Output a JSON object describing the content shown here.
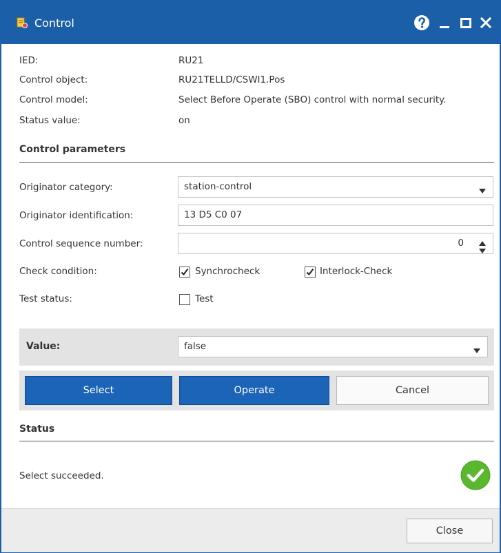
{
  "window": {
    "title": "Control"
  },
  "info": {
    "ied_label": "IED:",
    "ied_value": "RU21",
    "control_object_label": "Control object:",
    "control_object_value": "RU21TELLD/CSWI1.Pos",
    "control_model_label": "Control model:",
    "control_model_value": "Select Before Operate (SBO) control with normal security.",
    "status_value_label": "Status value:",
    "status_value_value": "on"
  },
  "control_parameters": {
    "title": "Control parameters",
    "originator_category_label": "Originator category:",
    "originator_category_value": "station-control",
    "originator_identification_label": "Originator identification:",
    "originator_identification_value": "13 D5 C0 07",
    "control_sequence_label": "Control sequence number:",
    "control_sequence_value": "0",
    "check_condition_label": "Check condition:",
    "synchrocheck_label": "Synchrocheck",
    "synchrocheck_checked": true,
    "interlock_label": "Interlock-Check",
    "interlock_checked": true,
    "test_status_label": "Test status:",
    "test_label": "Test",
    "test_checked": false
  },
  "value": {
    "label": "Value:",
    "selected": "false"
  },
  "actions": {
    "select_label": "Select",
    "operate_label": "Operate",
    "cancel_label": "Cancel"
  },
  "status": {
    "title": "Status",
    "message": "Select succeeded."
  },
  "footer": {
    "close_label": "Close"
  },
  "colors": {
    "titlebar": "#1b5fa8",
    "primary_button": "#1c64b8",
    "success": "#5ab82e"
  }
}
